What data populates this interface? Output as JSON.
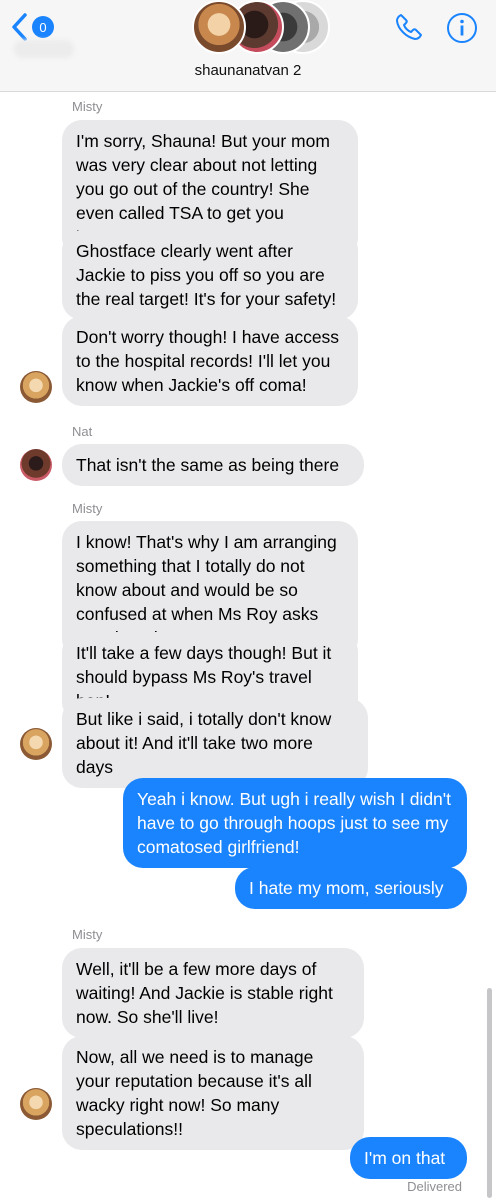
{
  "header": {
    "back_badge": "0",
    "group_name": "shaunanatvan 2",
    "icons": {
      "back": "chevron-left-icon",
      "phone": "phone-icon",
      "info": "info-icon"
    },
    "accent": "#1a84ff"
  },
  "messages": [
    {
      "sender": "Misty",
      "direction": "in",
      "text": "I'm sorry, Shauna! But your mom was very  clear about not letting you go out of the country! She even called TSA to get you banned!"
    },
    {
      "direction": "in",
      "text": "Ghostface clearly went after Jackie to piss you off so you are the real target! It's for your safety!"
    },
    {
      "direction": "in",
      "text": "Don't worry though! I have access to the hospital records! I'll let you know when Jackie's off coma!"
    },
    {
      "sender": "Nat",
      "direction": "in",
      "text": "That isn't the same as being there"
    },
    {
      "sender": "Misty",
      "direction": "in",
      "text": "I know! That's why I am arranging something that I totally do not know about and would be so confused at when Ms Roy asks me about it!"
    },
    {
      "direction": "in",
      "text": "It'll take a few days though! But it should bypass Ms Roy's travel ban!"
    },
    {
      "direction": "in",
      "text": "But like i said, i totally don't know about it! And it'll take two more days"
    },
    {
      "direction": "out",
      "text": "Yeah i know. But ugh i really wish I didn't have to go through hoops just to see my comatosed girlfriend!"
    },
    {
      "direction": "out",
      "text": "I hate my mom, seriously"
    },
    {
      "sender": "Misty",
      "direction": "in",
      "text": "Well, it'll be a few more days of waiting! And Jackie is stable right now. So she'll live!"
    },
    {
      "direction": "in",
      "text": "Now, all we need is to manage your reputation because it's all wacky right now! So many speculations!!"
    },
    {
      "direction": "out",
      "text": "I'm on that"
    }
  ],
  "status": {
    "delivered": "Delivered"
  }
}
